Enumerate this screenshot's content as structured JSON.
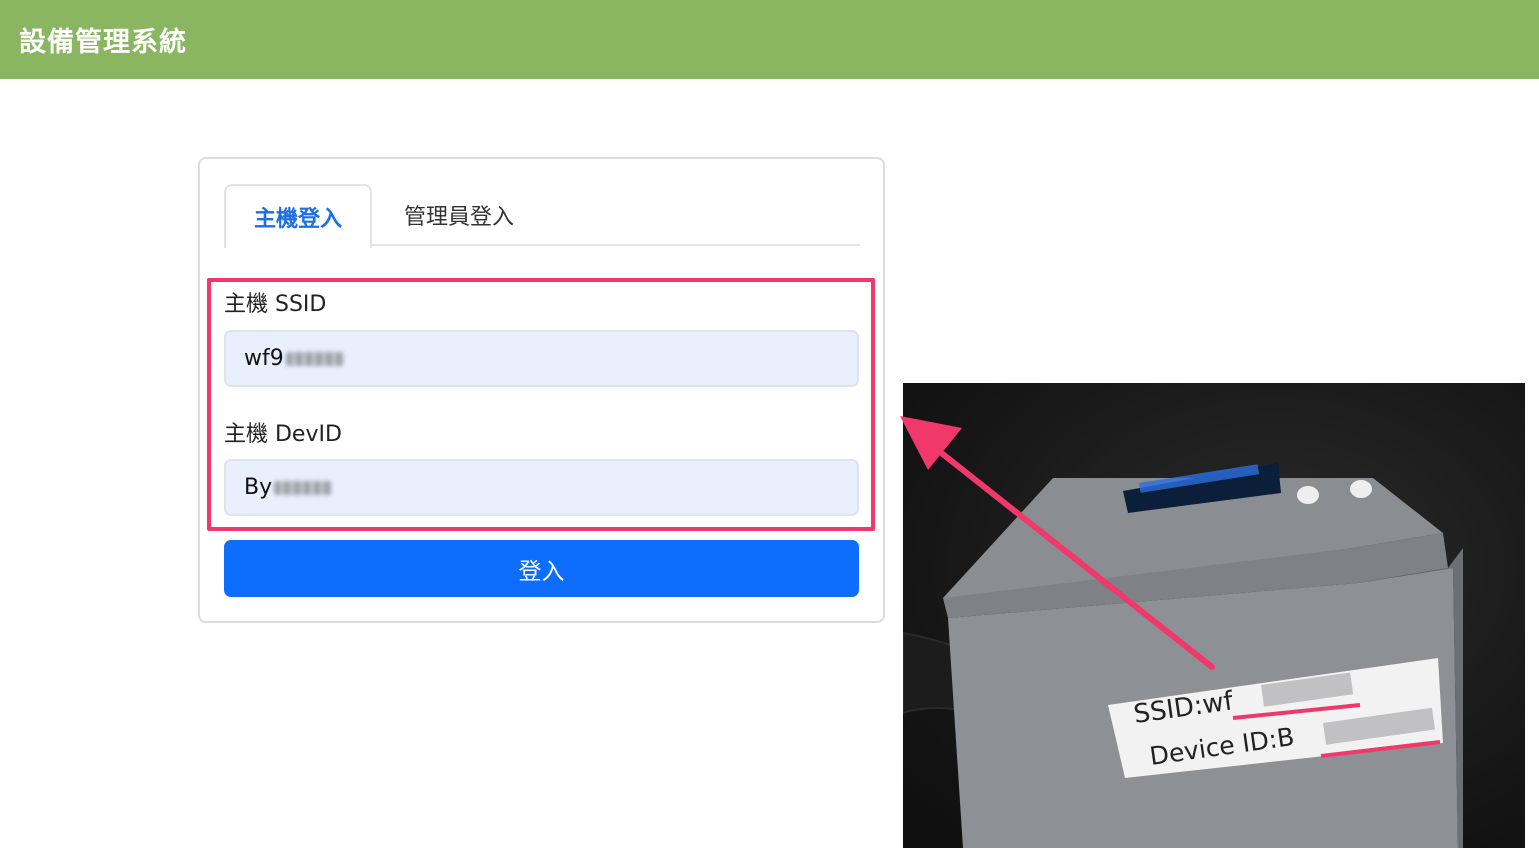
{
  "header": {
    "title": "設備管理系統"
  },
  "tabs": [
    {
      "label": "主機登入",
      "active": true
    },
    {
      "label": "管理員登入",
      "active": false
    }
  ],
  "form": {
    "ssid_label": "主機 SSID",
    "ssid_value": "wf9",
    "devid_label": "主機 DevID",
    "devid_value": "By",
    "login_label": "登入"
  },
  "photo": {
    "ssid_text": "SSID:wf",
    "device_text": "Device ID:B"
  },
  "colors": {
    "header_bg": "#8ab662",
    "accent": "#0d6efd",
    "highlight": "#f0386b"
  }
}
